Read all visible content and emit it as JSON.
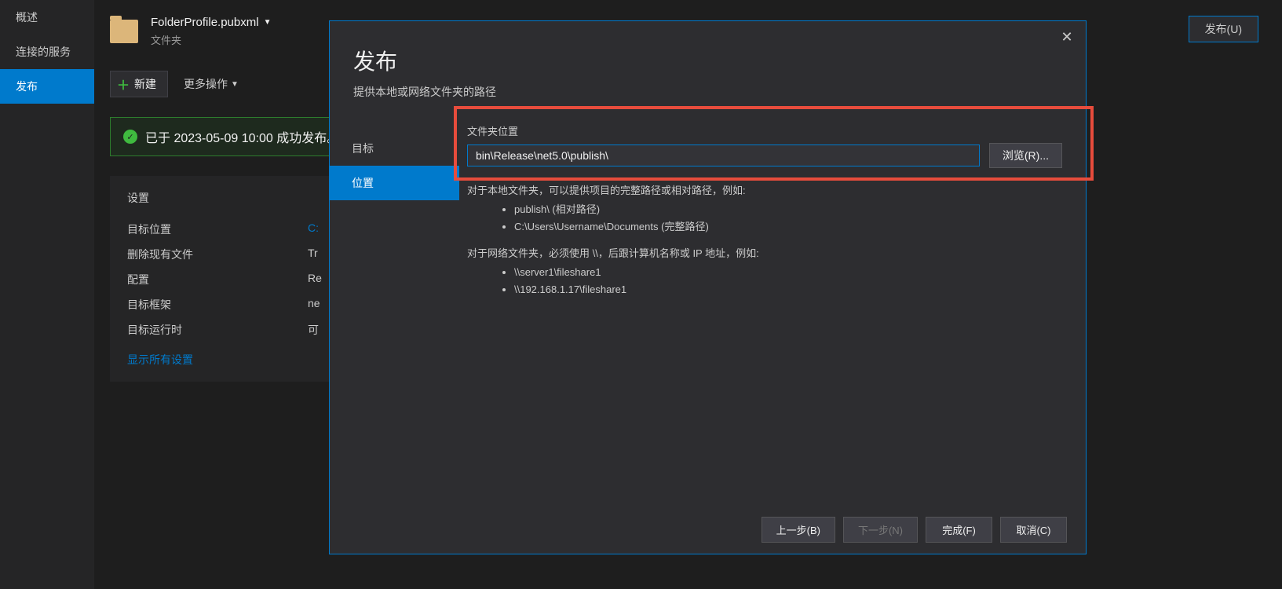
{
  "sidebar": {
    "items": [
      {
        "label": "概述"
      },
      {
        "label": "连接的服务"
      },
      {
        "label": "发布"
      }
    ]
  },
  "profile": {
    "name": "FolderProfile.pubxml",
    "type": "文件夹",
    "publish_button": "发布(U)"
  },
  "toolbar": {
    "new_label": "新建",
    "more_actions": "更多操作"
  },
  "status": {
    "message": "已于 2023-05-09 10:00 成功发布。"
  },
  "settings": {
    "title": "设置",
    "rows": [
      {
        "label": "目标位置",
        "value": "C:"
      },
      {
        "label": "删除现有文件",
        "value": "Tr"
      },
      {
        "label": "配置",
        "value": "Re"
      },
      {
        "label": "目标框架",
        "value": "ne"
      },
      {
        "label": "目标运行时",
        "value": "可"
      }
    ],
    "show_all": "显示所有设置"
  },
  "dialog": {
    "title": "发布",
    "subtitle": "提供本地或网络文件夹的路径",
    "nav": [
      {
        "label": "目标"
      },
      {
        "label": "位置"
      }
    ],
    "field_label": "文件夹位置",
    "path_value": "bin\\Release\\net5.0\\publish\\",
    "browse_label": "浏览(R)...",
    "help": {
      "local_intro": "对于本地文件夹，可以提供项目的完整路径或相对路径，例如:",
      "local_ex1": "publish\\ (相对路径)",
      "local_ex2": "C:\\Users\\Username\\Documents (完整路径)",
      "net_intro": "对于网络文件夹，必须使用 \\\\，后跟计算机名称或 IP 地址，例如:",
      "net_ex1": "\\\\server1\\fileshare1",
      "net_ex2": "\\\\192.168.1.17\\fileshare1"
    },
    "footer": {
      "back": "上一步(B)",
      "next": "下一步(N)",
      "finish": "完成(F)",
      "cancel": "取消(C)"
    }
  }
}
